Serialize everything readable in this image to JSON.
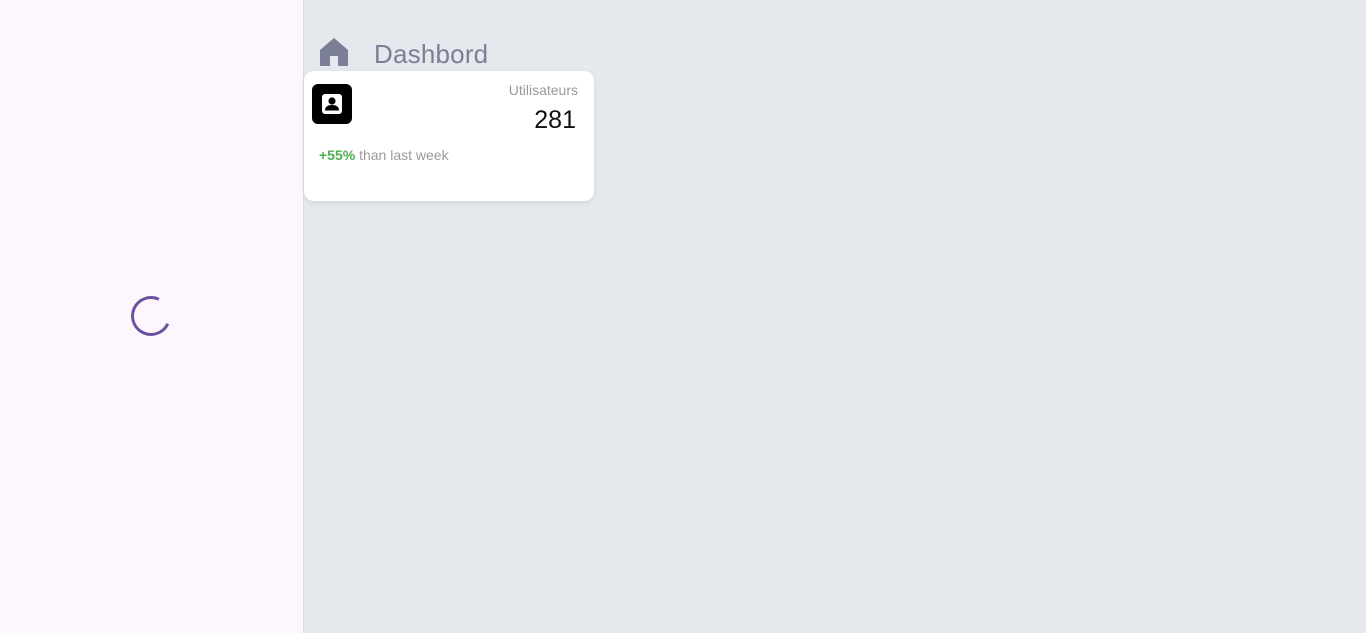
{
  "header": {
    "title": "Dashbord",
    "icon": "home-icon",
    "icon_color": "#7b7f95"
  },
  "sidebar": {
    "loading_indicator": "spinner-icon",
    "accent_color": "#6b52a1"
  },
  "stats_card": {
    "icon": "person-icon",
    "label": "Utilisateurs",
    "value": "281",
    "change": "+55%",
    "change_color": "#4caf50",
    "change_text": " than last week"
  }
}
